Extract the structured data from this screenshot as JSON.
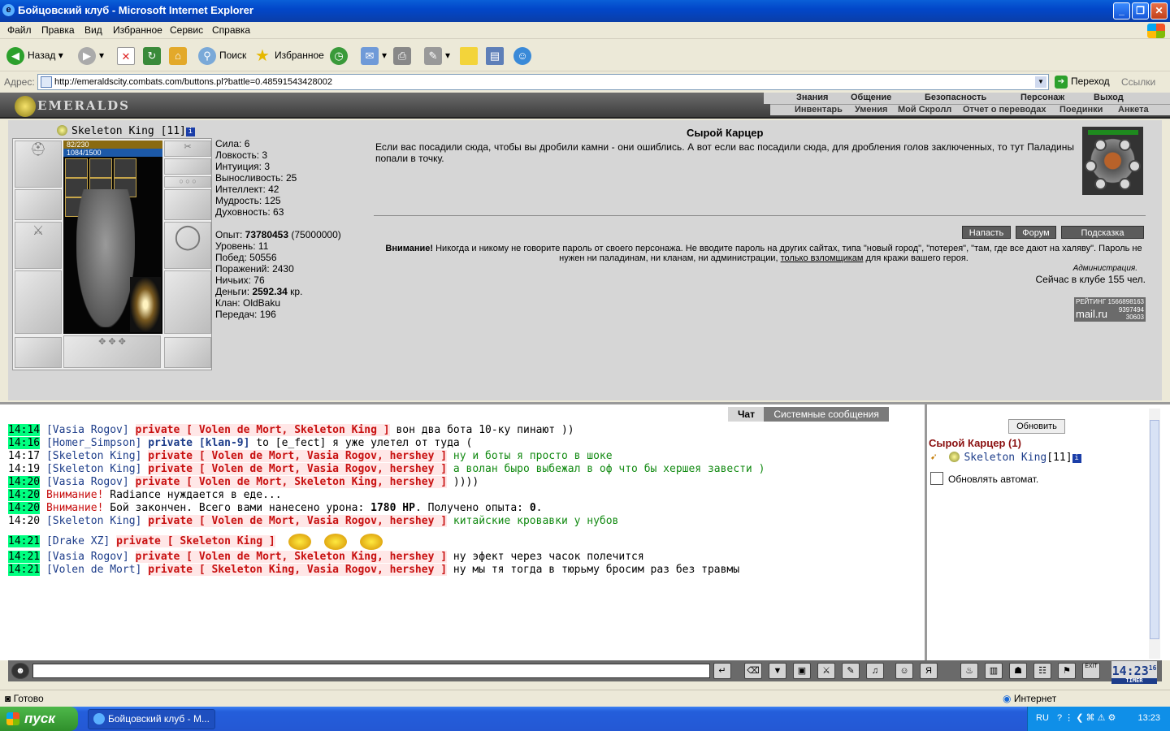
{
  "window": {
    "title": "Бойцовский клуб - Microsoft Internet Explorer"
  },
  "menu": [
    "Файл",
    "Правка",
    "Вид",
    "Избранное",
    "Сервис",
    "Справка"
  ],
  "toolbar": {
    "back": "Назад",
    "search": "Поиск",
    "favorites": "Избранное"
  },
  "address": {
    "label": "Адрес:",
    "url": "http://emeraldscity.combats.com/buttons.pl?battle=0.48591543428002",
    "go": "Переход",
    "links": "Ссылки"
  },
  "game": {
    "logo": "EMERALDS",
    "nav_top": [
      "Знания",
      "Общение",
      "Безопасность",
      "Персонаж",
      "Выход"
    ],
    "nav_sub": [
      "Инвентарь",
      "Умения",
      "Мой Скролл",
      "Отчет о переводах",
      "Поединки",
      "Анкета"
    ]
  },
  "character": {
    "name": "Skeleton King",
    "level": "[11]",
    "hp": "82/230",
    "mana": "1084/1500",
    "stats": [
      {
        "label": "Сила:",
        "value": "6"
      },
      {
        "label": "Ловкость:",
        "value": "3"
      },
      {
        "label": "Интуиция:",
        "value": "3"
      },
      {
        "label": "Выносливость:",
        "value": "25"
      },
      {
        "label": "Интеллект:",
        "value": "42"
      },
      {
        "label": "Мудрость:",
        "value": "125"
      },
      {
        "label": "Духовность:",
        "value": "63"
      }
    ],
    "info": {
      "exp_label": "Опыт:",
      "exp": "73780453",
      "exp_next": "(75000000)",
      "level_label": "Уровень:",
      "level": "11",
      "wins_label": "Побед:",
      "wins": "50556",
      "losses_label": "Поражений:",
      "losses": "2430",
      "draws_label": "Ничьих:",
      "draws": "76",
      "money_label": "Деньги:",
      "money": "2592.34",
      "money_unit": "кр.",
      "clan_label": "Клан:",
      "clan": "OldBaku",
      "transfers_label": "Передач:",
      "transfers": "196"
    }
  },
  "location": {
    "name": "Сырой Карцер",
    "description": "Если вас посадили сюда, чтобы вы дробили камни - они ошиблись. А вот если вас посадили сюда, для дробления голов заключенных, то тут Паладины попали в точку.",
    "buttons": [
      "Напасть",
      "Форум",
      "Подсказка"
    ],
    "warning_bold": "Внимание!",
    "warning_text": "Никогда и никому не говорите пароль от своего персонажа. Не вводите пароль на других сайтах, типа \"новый город\", \"потерея\", \"там, где все дают на халяву\". Пароль не нужен ни паладинам, ни кланам, ни администрации,",
    "warning_link": "только взломщикам",
    "warning_tail": "для кражи вашего героя.",
    "admin": "Администрация.",
    "online": "Сейчас в клубе 155 чел.",
    "rating": {
      "label": "РЕЙТИНГ",
      "brand": "mail.ru",
      "n1": "1566898163",
      "n2": "9397494",
      "n3": "30603"
    }
  },
  "chat": {
    "tabs": [
      "Чат",
      "Системные сообщения"
    ],
    "messages": [
      {
        "time": "14:14",
        "nick": "[Vasia Rogov]",
        "priv": "private [ Volen de Mort, Skeleton King ]",
        "text": "вон два бота 10-ку пинают ))"
      },
      {
        "time": "14:16",
        "nick": "[Homer_Simpson]",
        "priv": "private [klan-9]",
        "text": "to [e_fect] я уже улетел от туда ("
      },
      {
        "time": "14:17",
        "nick": "[Skeleton King]",
        "priv": "private [ Volen de Mort, Vasia Rogov, hershey ]",
        "text": "ну и боты я просто в шоке"
      },
      {
        "time": "14:19",
        "nick": "[Skeleton King]",
        "priv": "private [ Volen de Mort, Vasia Rogov, hershey ]",
        "text": "а волан быро выбежал в оф что бы хершея завести )"
      },
      {
        "time": "14:20",
        "nick": "[Vasia Rogov]",
        "priv": "private [ Volen de Mort, Skeleton King, hershey ]",
        "text": "))))"
      },
      {
        "time": "14:20",
        "sys": "Внимание!",
        "text": "Radiance нуждается в еде..."
      },
      {
        "time": "14:20",
        "sys": "Внимание!",
        "text": "Бой закончен. Всего вами нанесено урона:",
        "dmg": "1780 HP",
        "tail": ". Получено опыта:",
        "xp": "0",
        "end": "."
      },
      {
        "time": "14:20",
        "nick": "[Skeleton King]",
        "priv": "private [ Volen de Mort, Vasia Rogov, hershey ]",
        "text": "китайские кровавки у нубов"
      },
      {
        "time": "14:21",
        "nick": "[Drake XZ]",
        "priv": "private [ Skeleton King ]",
        "text": ""
      },
      {
        "time": "14:21",
        "nick": "[Vasia Rogov]",
        "priv": "private [ Volen de Mort, Skeleton King, hershey ]",
        "text": "ну эфект через часок полечится"
      },
      {
        "time": "14:21",
        "nick": "[Volen de Mort]",
        "priv": "private [ Skeleton King, Vasia Rogov, hershey ]",
        "text": "ну мы тя тогда в тюрьму бросим раз без травмы"
      }
    ]
  },
  "room": {
    "refresh": "Обновить",
    "name": "Сырой Карцер (1)",
    "user": "Skeleton King",
    "user_level": "[11]",
    "auto": "Обновлять автомат."
  },
  "clock": {
    "time": "14:23",
    "sec": "16",
    "exit": "EXIT",
    "timer": "TIMER"
  },
  "status": {
    "left": "Готово",
    "zone": "Интернет"
  },
  "taskbar": {
    "start": "пуск",
    "task": "Бойцовский клуб - M...",
    "lang": "RU",
    "time": "13:23"
  }
}
